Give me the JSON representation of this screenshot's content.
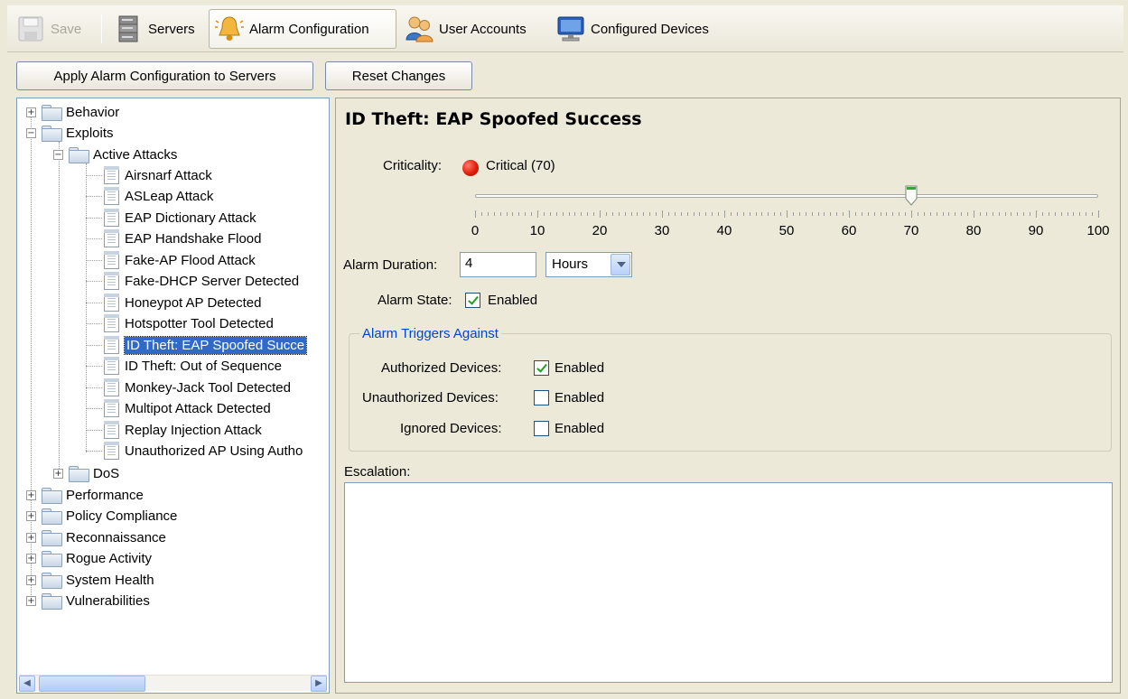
{
  "toolbar": {
    "save_label": "Save",
    "servers_label": "Servers",
    "alarm_config_label": "Alarm Configuration",
    "user_accounts_label": "User Accounts",
    "configured_devices_label": "Configured Devices"
  },
  "actions": {
    "apply_label": "Apply Alarm Configuration to Servers",
    "reset_label": "Reset Changes"
  },
  "tree": {
    "behavior": "Behavior",
    "exploits": "Exploits",
    "active_attacks": "Active Attacks",
    "attacks": [
      "Airsnarf Attack",
      "ASLeap Attack",
      "EAP Dictionary Attack",
      "EAP Handshake Flood",
      "Fake-AP Flood Attack",
      "Fake-DHCP Server Detected",
      "Honeypot AP Detected",
      "Hotspotter Tool Detected",
      "ID Theft: EAP Spoofed Succe",
      "ID Theft: Out of Sequence",
      "Monkey-Jack Tool Detected",
      "Multipot Attack Detected",
      "Replay Injection Attack",
      "Unauthorized AP Using Autho"
    ],
    "dos": "DoS",
    "performance": "Performance",
    "policy_compliance": "Policy Compliance",
    "reconnaissance": "Reconnaissance",
    "rogue_activity": "Rogue Activity",
    "system_health": "System Health",
    "vulnerabilities": "Vulnerabilities"
  },
  "detail": {
    "title": "ID Theft: EAP Spoofed Success",
    "criticality_label": "Criticality:",
    "criticality_value": "Critical (70)",
    "criticality_color": "#e01d0c",
    "slider": {
      "value": 70,
      "min": 0,
      "max": 100,
      "tick_labels": [
        "0",
        "10",
        "20",
        "30",
        "40",
        "50",
        "60",
        "70",
        "80",
        "90",
        "100"
      ]
    },
    "duration_label": "Alarm Duration:",
    "duration_value": "4",
    "duration_unit": "Hours",
    "state_label": "Alarm State:",
    "state_checkbox_label": "Enabled",
    "state_enabled": true,
    "triggers_legend": "Alarm Triggers Against",
    "authorized_label": "Authorized Devices:",
    "authorized_checkbox_label": "Enabled",
    "authorized_enabled": true,
    "unauthorized_label": "Unauthorized Devices:",
    "unauthorized_checkbox_label": "Enabled",
    "unauthorized_enabled": false,
    "ignored_label": "Ignored Devices:",
    "ignored_checkbox_label": "Enabled",
    "ignored_enabled": false,
    "escalation_label": "Escalation:",
    "escalation_value": ""
  },
  "colors": {
    "accent": "#316ac5",
    "legend": "#0046d5",
    "window_bg": "#ece9d8"
  }
}
